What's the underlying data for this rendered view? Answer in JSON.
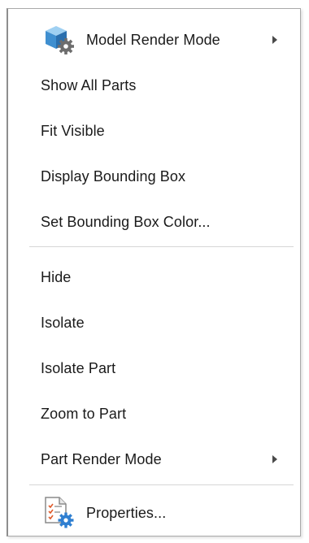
{
  "menu": {
    "items": [
      {
        "label": "Model Render Mode",
        "submenu": true,
        "icon": "cube-gear-icon"
      },
      {
        "label": "Show All Parts"
      },
      {
        "label": "Fit Visible"
      },
      {
        "label": "Display Bounding Box"
      },
      {
        "label": "Set Bounding Box Color..."
      },
      {
        "label": "Hide"
      },
      {
        "label": "Isolate"
      },
      {
        "label": "Isolate Part"
      },
      {
        "label": "Zoom to Part"
      },
      {
        "label": "Part Render Mode",
        "submenu": true
      },
      {
        "label": "Properties...",
        "icon": "document-gear-icon"
      }
    ]
  }
}
